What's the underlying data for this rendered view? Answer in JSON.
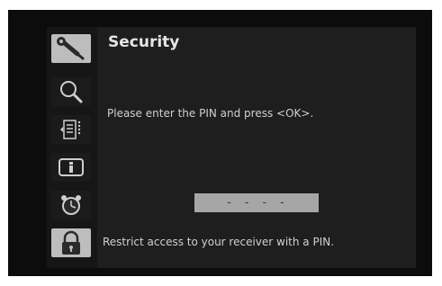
{
  "header": {
    "title": "Security"
  },
  "sidebar": {
    "items": [
      {
        "icon": "wrench-icon",
        "label": "",
        "active": true
      },
      {
        "icon": "magnifier-icon",
        "label": "",
        "active": false
      },
      {
        "icon": "channel-list-icon",
        "label": "",
        "active": false
      },
      {
        "icon": "info-card-icon",
        "label": "",
        "active": false
      },
      {
        "icon": "alarm-clock-icon",
        "label": "",
        "active": false
      },
      {
        "icon": "padlock-icon",
        "label": "",
        "active": true
      }
    ]
  },
  "main": {
    "prompt": "Please enter the PIN and press <OK>.",
    "pin_input": {
      "value": "- - - -"
    },
    "help": "Restrict access to your receiver with a PIN."
  },
  "colors": {
    "background": "#0c0c0c",
    "panel": "#1e1e1e",
    "active_icon_bg": "#bdbdbd",
    "pin_field": "#a6a6a6",
    "text": "#d0d0d0"
  }
}
